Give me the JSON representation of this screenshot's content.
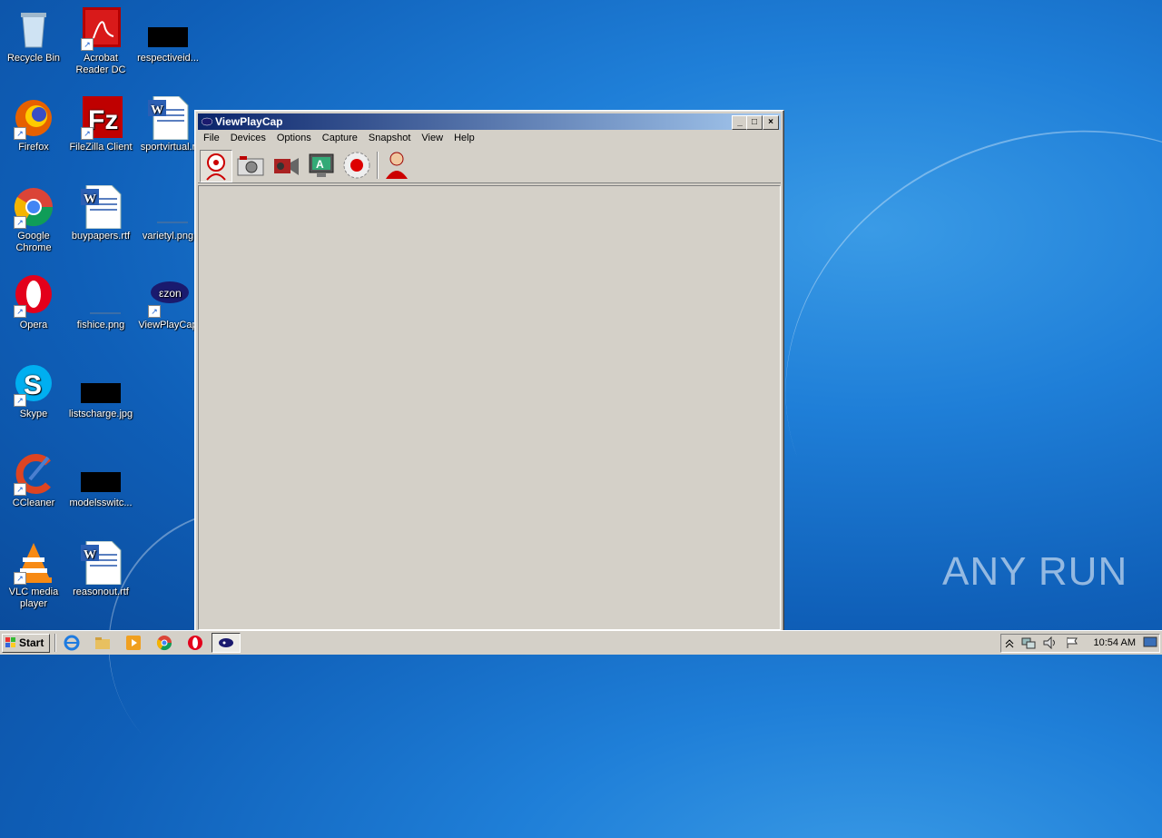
{
  "desktop": {
    "icons": [
      {
        "label": "Recycle Bin"
      },
      {
        "label": "Acrobat Reader DC"
      },
      {
        "label": "respectiveid..."
      },
      {
        "label": "Firefox"
      },
      {
        "label": "FileZilla Client"
      },
      {
        "label": "sportvirtual.r"
      },
      {
        "label": "Google Chrome"
      },
      {
        "label": "buypapers.rtf"
      },
      {
        "label": "varietyl.png"
      },
      {
        "label": "Opera"
      },
      {
        "label": "fishice.png"
      },
      {
        "label": "ViewPlayCap"
      },
      {
        "label": "Skype"
      },
      {
        "label": "listscharge.jpg"
      },
      {
        "label": "CCleaner"
      },
      {
        "label": "modelsswitc..."
      },
      {
        "label": "VLC media player"
      },
      {
        "label": "reasonout.rtf"
      }
    ]
  },
  "window": {
    "title": "ViewPlayCap",
    "controls": {
      "minimize": "_",
      "maximize": "□",
      "close": "×"
    },
    "menu": [
      "File",
      "Devices",
      "Options",
      "Capture",
      "Snapshot",
      "View",
      "Help"
    ],
    "toolbar": [
      "webcam-icon",
      "camera-icon",
      "camcorder-icon",
      "monitor-icon",
      "record-icon",
      "user-icon"
    ]
  },
  "taskbar": {
    "start_label": "Start",
    "clock": "10:54 AM"
  },
  "watermark": "ANY RUN"
}
